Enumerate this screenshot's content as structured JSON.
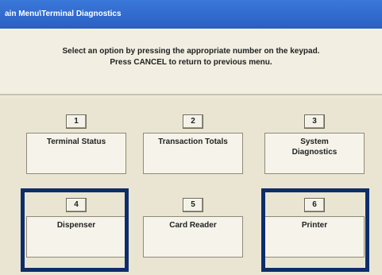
{
  "window": {
    "title": "ain Menu\\Terminal Diagnostics"
  },
  "instructions": {
    "line1": "Select an option by pressing the appropriate number on the keypad.",
    "line2": "Press CANCEL to return to previous menu."
  },
  "options": [
    {
      "number": "1",
      "label": "Terminal Status"
    },
    {
      "number": "2",
      "label": "Transaction Totals"
    },
    {
      "number": "3",
      "label": "System\nDiagnostics"
    },
    {
      "number": "4",
      "label": "Dispenser"
    },
    {
      "number": "5",
      "label": "Card Reader"
    },
    {
      "number": "6",
      "label": "Printer"
    }
  ],
  "colors": {
    "title_bar": "#2a5fc4",
    "highlight_border": "#0d2d6b",
    "background": "#ece8d6"
  }
}
